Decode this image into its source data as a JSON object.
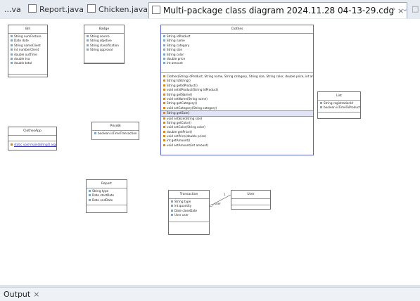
{
  "tabs": [
    {
      "label": "...va"
    },
    {
      "label": "Report.java"
    },
    {
      "label": "Chicken.java"
    },
    {
      "label": "Multi-package class diagram 2024.11.28 04-13-29.cdg"
    }
  ],
  "close_glyph": "×",
  "nav": {
    "prev": "‹",
    "next": "›",
    "menu": "⌄",
    "maximize": "□"
  },
  "classes": {
    "bill": {
      "name": "Bill",
      "fields": [
        "String numFacture",
        "Date date",
        "String nameClient",
        "int numberClient",
        "double outTime",
        "double tva",
        "double total"
      ],
      "methods": []
    },
    "badge": {
      "name": "Badge",
      "fields": [
        "String source",
        "String objetive",
        "String classification",
        "String approval"
      ],
      "methods": []
    },
    "clothes": {
      "name": "Clothes",
      "fields": [
        "String idProduct",
        "String name",
        "String category",
        "String size",
        "String color",
        "double price",
        "int amount"
      ],
      "methods": [
        "Clothes(String idProduct, String name, String category, String size, String color, double price, int amou",
        "String toString()",
        "String getIdProduct()",
        "void setIdProduct(String idProduct)",
        "String getName()",
        "void setName(String name)",
        "String getCategory()",
        "void setCategory(String category)",
        "String getSize()",
        "void setSize(String size)",
        "String getColor()",
        "void setColor(String color)",
        "double getPrice()",
        "void setPrice(double price)",
        "int getAmount()",
        "void setAmount(int amount)"
      ]
    },
    "list": {
      "name": "List",
      "fields": [
        "String registrationId",
        "boolean isTimeToProduct"
      ],
      "methods": []
    },
    "clothesapp": {
      "name": "ClothesApp",
      "fields": [],
      "methods": [
        "static void main(String[] args)"
      ]
    },
    "pricebi": {
      "name": "PriceBi",
      "fields": [
        "boolean isTimeTransaction"
      ],
      "methods": []
    },
    "report": {
      "name": "Report",
      "fields": [
        "String type",
        "Date startDate",
        "Date endDate"
      ],
      "methods": []
    },
    "transaction": {
      "name": "Transaction",
      "fields": [
        "String type",
        "int quantity",
        "Date closeDate",
        "User user"
      ],
      "methods": []
    },
    "user": {
      "name": "User",
      "fields": [],
      "methods": []
    }
  },
  "association": {
    "role": "user",
    "multiplicity": "1"
  },
  "output": {
    "tab_label": "Output"
  }
}
